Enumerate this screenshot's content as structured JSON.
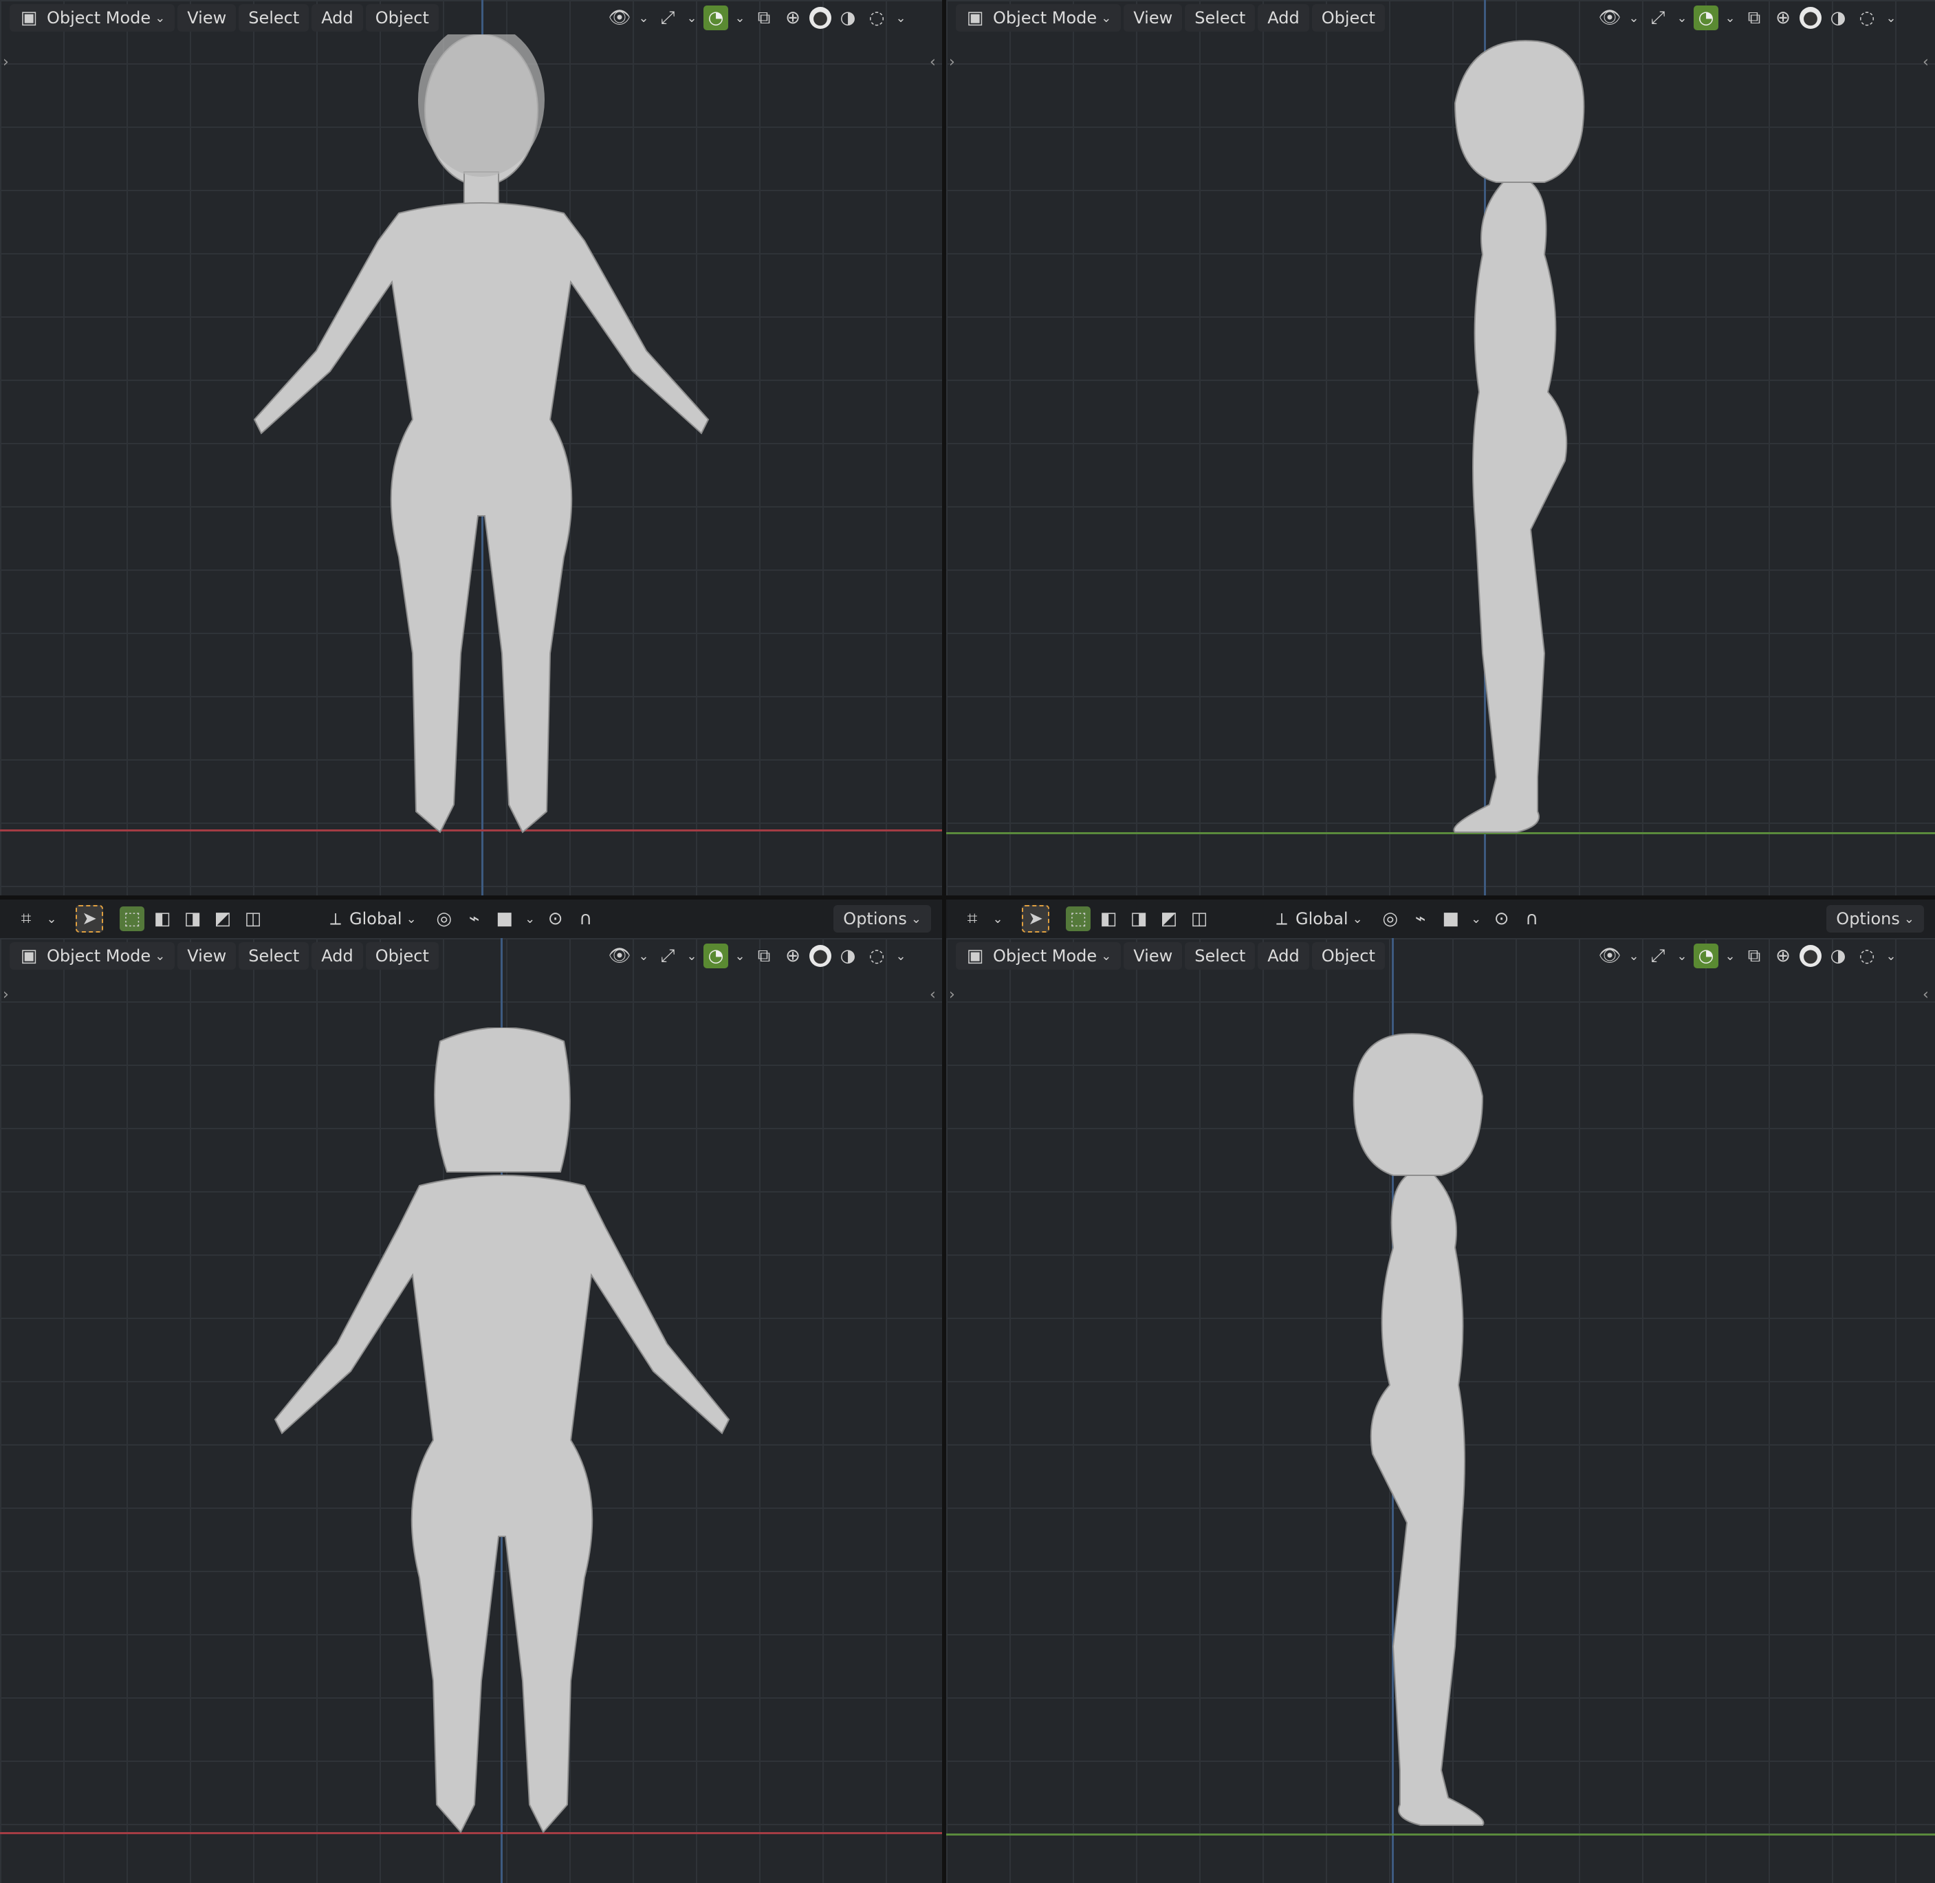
{
  "header": {
    "mode_label": "Object Mode",
    "menu": [
      "View",
      "Select",
      "Add",
      "Object"
    ]
  },
  "toolbar": {
    "orientation_label": "Global",
    "options_label": "Options"
  },
  "colors": {
    "x_axis": "#a43c44",
    "y_axis": "#5a8a3c",
    "z_axis": "#3d5a80",
    "accent_green": "#5a8a32",
    "select_dash": "#e0a040",
    "mesh": "#c9c9c9"
  },
  "icons": {
    "mode": "object-mode-icon",
    "visibility": "eye-icon",
    "gizmo": "gizmo-icon",
    "overlay": "overlay-icon",
    "xray": "xray-icon",
    "wireframe": "wireframe-shading-icon",
    "solid": "solid-shading-icon",
    "material": "material-shading-icon",
    "rendered": "rendered-shading-icon",
    "transform_pivot": "pivot-icon",
    "snap": "snap-icon",
    "proportional": "proportional-edit-icon",
    "select_tool": "cursor-select-icon",
    "select_box": "select-box-icon"
  }
}
